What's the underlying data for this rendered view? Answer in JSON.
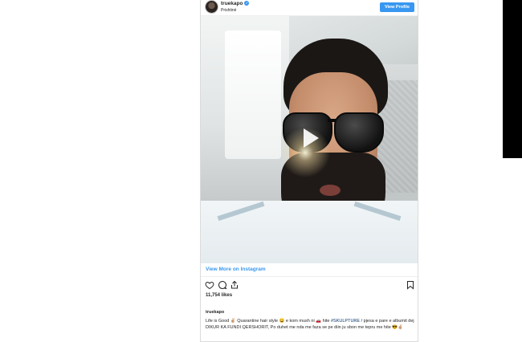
{
  "header": {
    "username": "truekapo",
    "location": "Prishtinë",
    "view_profile_label": "View Profile"
  },
  "media": {
    "view_more_label": "View More on Instagram"
  },
  "post": {
    "likes": "11,754 likes",
    "caption_user": "truekapo",
    "caption_part1": "Life is Good ✌🏼 Quarantine hair style 😀 e kom mush ni 🚗 hite",
    "hashtag": "#SKULPTURE",
    "caption_part2": "/ pjesa e pare e albumit dej DIKUR KA FUNDI QERSHORIT, Po duhet me nda me faza se pe diin ju sbon me tepru me hite 😎✌🏼"
  },
  "colors": {
    "accent": "#3897f0",
    "text": "#262626",
    "border": "#dbdbdb"
  },
  "icons": [
    "verified-badge-icon",
    "heart-icon",
    "comment-icon",
    "share-icon",
    "bookmark-icon",
    "play-icon"
  ]
}
